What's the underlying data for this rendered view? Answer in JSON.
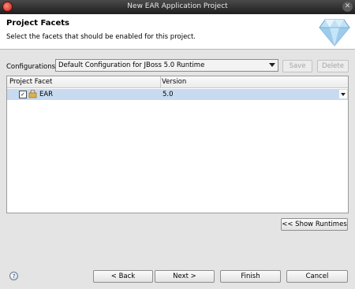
{
  "window": {
    "title": "New EAR Application Project"
  },
  "header": {
    "title": "Project Facets",
    "description": "Select the facets that should be enabled for this project."
  },
  "configuration": {
    "label": "Configurations:",
    "selected": "Default Configuration for JBoss 5.0 Runtime",
    "save_label": "Save",
    "delete_label": "Delete"
  },
  "facets_table": {
    "columns": [
      "Project Facet",
      "Version"
    ],
    "rows": [
      {
        "facet": "EAR",
        "version": "5.0",
        "checked": true
      }
    ]
  },
  "show_runtimes_label": "<< Show Runtimes",
  "footer": {
    "back_label": "< Back",
    "next_label": "Next >",
    "finish_label": "Finish",
    "cancel_label": "Cancel"
  },
  "icons": [
    "app-icon",
    "close-icon",
    "diamond-icon",
    "facet-icon",
    "help-icon"
  ]
}
